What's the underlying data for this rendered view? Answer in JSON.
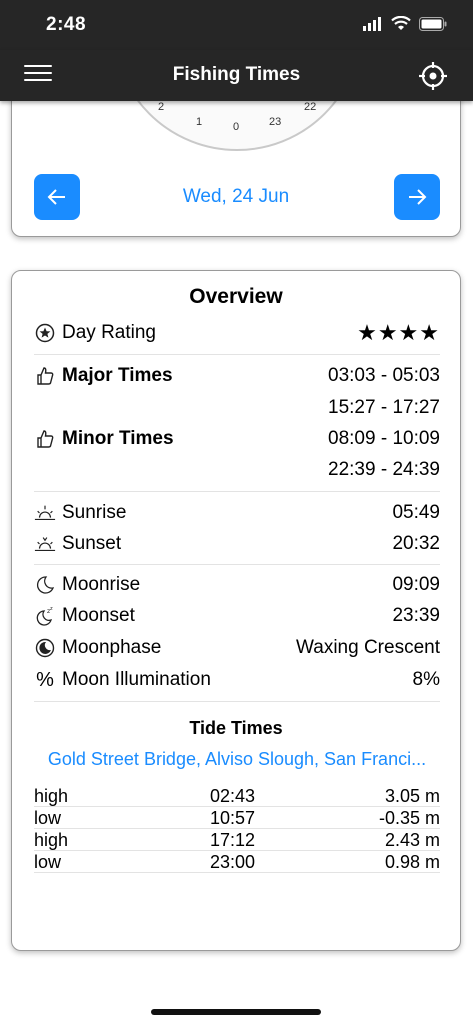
{
  "status": {
    "time": "2:48"
  },
  "nav": {
    "title": "Fishing Times"
  },
  "dial": {
    "numbers": [
      "2",
      "1",
      "0",
      "23",
      "22"
    ]
  },
  "date_picker": {
    "date": "Wed, 24 Jun"
  },
  "overview": {
    "title": "Overview",
    "day_rating": {
      "label": "Day Rating",
      "value": "★★★★"
    },
    "major_times": {
      "label": "Major Times",
      "values": [
        "03:03 - 05:03",
        "15:27 - 17:27"
      ]
    },
    "minor_times": {
      "label": "Minor Times",
      "values": [
        "08:09 - 10:09",
        "22:39 - 24:39"
      ]
    },
    "sunrise": {
      "label": "Sunrise",
      "value": "05:49"
    },
    "sunset": {
      "label": "Sunset",
      "value": "20:32"
    },
    "moonrise": {
      "label": "Moonrise",
      "value": "09:09"
    },
    "moonset": {
      "label": "Moonset",
      "value": "23:39"
    },
    "moonphase": {
      "label": "Moonphase",
      "value": "Waxing Crescent"
    },
    "illumination": {
      "label": "Moon Illumination",
      "icon_glyph": "%",
      "value": "8%"
    }
  },
  "tides": {
    "title": "Tide Times",
    "location": "Gold Street Bridge, Alviso Slough, San Franci...",
    "rows": [
      {
        "type": "high",
        "time": "02:43",
        "height": "3.05 m"
      },
      {
        "type": "low",
        "time": "10:57",
        "height": "-0.35 m"
      },
      {
        "type": "high",
        "time": "17:12",
        "height": "2.43 m"
      },
      {
        "type": "low",
        "time": "23:00",
        "height": "0.98 m"
      }
    ]
  },
  "colors": {
    "accent": "#1a8cff",
    "bar": "#262626"
  },
  "icons": [
    "hamburger-menu-icon",
    "crosshair-icon",
    "wifi-icon",
    "battery-icon",
    "signal-icon",
    "arrow-left-icon",
    "arrow-right-icon",
    "star-circle-icon",
    "thumbs-up-icon",
    "sunrise-icon",
    "sunset-icon",
    "moon-icon",
    "moonset-icon",
    "moonphase-icon",
    "percent-icon"
  ]
}
